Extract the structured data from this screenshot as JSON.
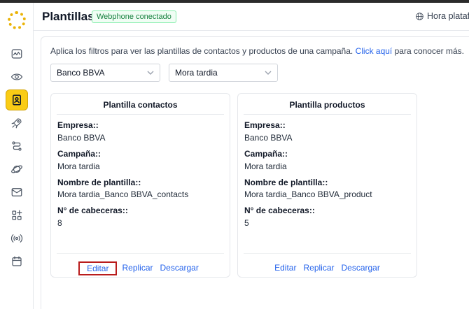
{
  "header": {
    "title": "Plantillas",
    "status_badge": "Webphone conectado",
    "time_label": "Hora platafo"
  },
  "sidebar": {
    "items": [
      {
        "icon": "activity-icon"
      },
      {
        "icon": "eye-icon"
      },
      {
        "icon": "contact-book-icon",
        "active": true
      },
      {
        "icon": "rocket-icon"
      },
      {
        "icon": "route-icon"
      },
      {
        "icon": "planet-icon"
      },
      {
        "icon": "mail-icon"
      },
      {
        "icon": "apps-add-icon"
      },
      {
        "icon": "broadcast-icon"
      },
      {
        "icon": "calendar-icon"
      }
    ]
  },
  "intro": {
    "text": "Aplica los filtros para ver las plantillas de contactos y productos de una campaña.",
    "link": "Click aquí",
    "suffix": "para conocer más."
  },
  "filters": {
    "company": "Banco BBVA",
    "campaign": "Mora tardia"
  },
  "cards": [
    {
      "title": "Plantilla contactos",
      "company_label": "Empresa::",
      "company_value": "Banco BBVA",
      "campaign_label": "Campaña::",
      "campaign_value": "Mora tardia",
      "template_label": "Nombre de plantilla::",
      "template_value": "Mora tardia_Banco BBVA_contacts",
      "headers_label": "N° de cabeceras::",
      "headers_value": "8",
      "edit": "Editar",
      "replicate": "Replicar",
      "download": "Descargar"
    },
    {
      "title": "Plantilla productos",
      "company_label": "Empresa::",
      "company_value": "Banco BBVA",
      "campaign_label": "Campaña::",
      "campaign_value": "Mora tardia",
      "template_label": "Nombre de plantilla::",
      "template_value": "Mora tardia_Banco BBVA_product",
      "headers_label": "N° de cabeceras::",
      "headers_value": "5",
      "edit": "Editar",
      "replicate": "Replicar",
      "download": "Descargar"
    }
  ],
  "colors": {
    "accent": "#facc15",
    "link": "#2563eb",
    "badge_green": "#15803d",
    "highlight_border": "#b91c1c"
  }
}
